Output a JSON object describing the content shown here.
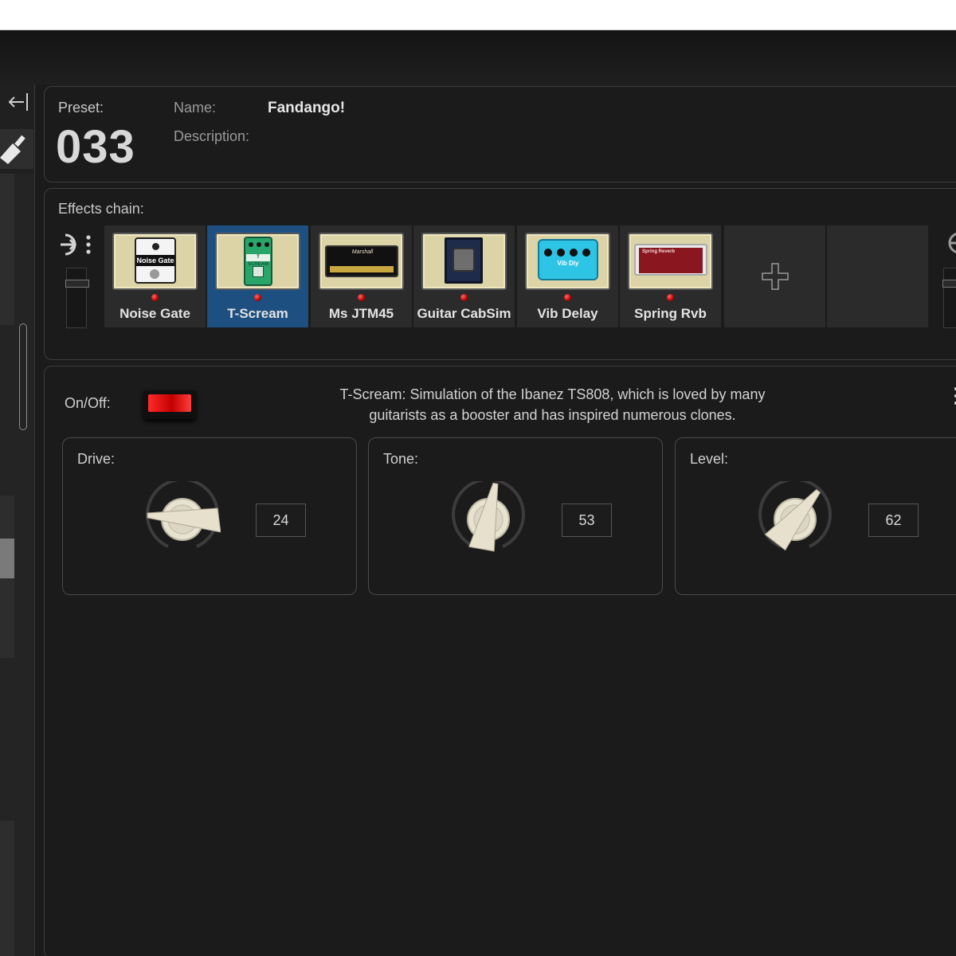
{
  "preset": {
    "label": "Preset:",
    "number": "033",
    "name_label": "Name:",
    "name": "Fandango!",
    "description_label": "Description:"
  },
  "left_strip": {
    "collapse_icon": "collapse-left-icon",
    "tool_icon": "brush-icon"
  },
  "chain": {
    "label": "Effects chain:",
    "input_icon": "input-icon",
    "add_icon": "plus-icon",
    "slots": [
      {
        "name": "Noise Gate",
        "selected": false,
        "art_text": "Noise Gate"
      },
      {
        "name": "T-Scream",
        "selected": true,
        "art_text": "T SCREAM"
      },
      {
        "name": "Ms JTM45",
        "selected": false,
        "art_text": "Marshall"
      },
      {
        "name": "Guitar CabSim",
        "selected": false,
        "art_text": ""
      },
      {
        "name": "Vib Delay",
        "selected": false,
        "art_text": "Vib Dly"
      },
      {
        "name": "Spring Rvb",
        "selected": false,
        "art_text": "Spring Reverb"
      }
    ]
  },
  "params": {
    "onoff_label": "On/Off:",
    "onoff_state": true,
    "description_line1": "T-Scream:  Simulation of the Ibanez TS808, which is loved by many",
    "description_line2": "guitarists as a booster and has inspired numerous clones.",
    "knobs": [
      {
        "label": "Drive:",
        "value": "24"
      },
      {
        "label": "Tone:",
        "value": "53"
      },
      {
        "label": "Level:",
        "value": "62"
      }
    ]
  },
  "colors": {
    "background": "#1b1b1b",
    "selected_slot": "#1d4f80",
    "led": "#d00000",
    "switch_on": "#e01010"
  }
}
